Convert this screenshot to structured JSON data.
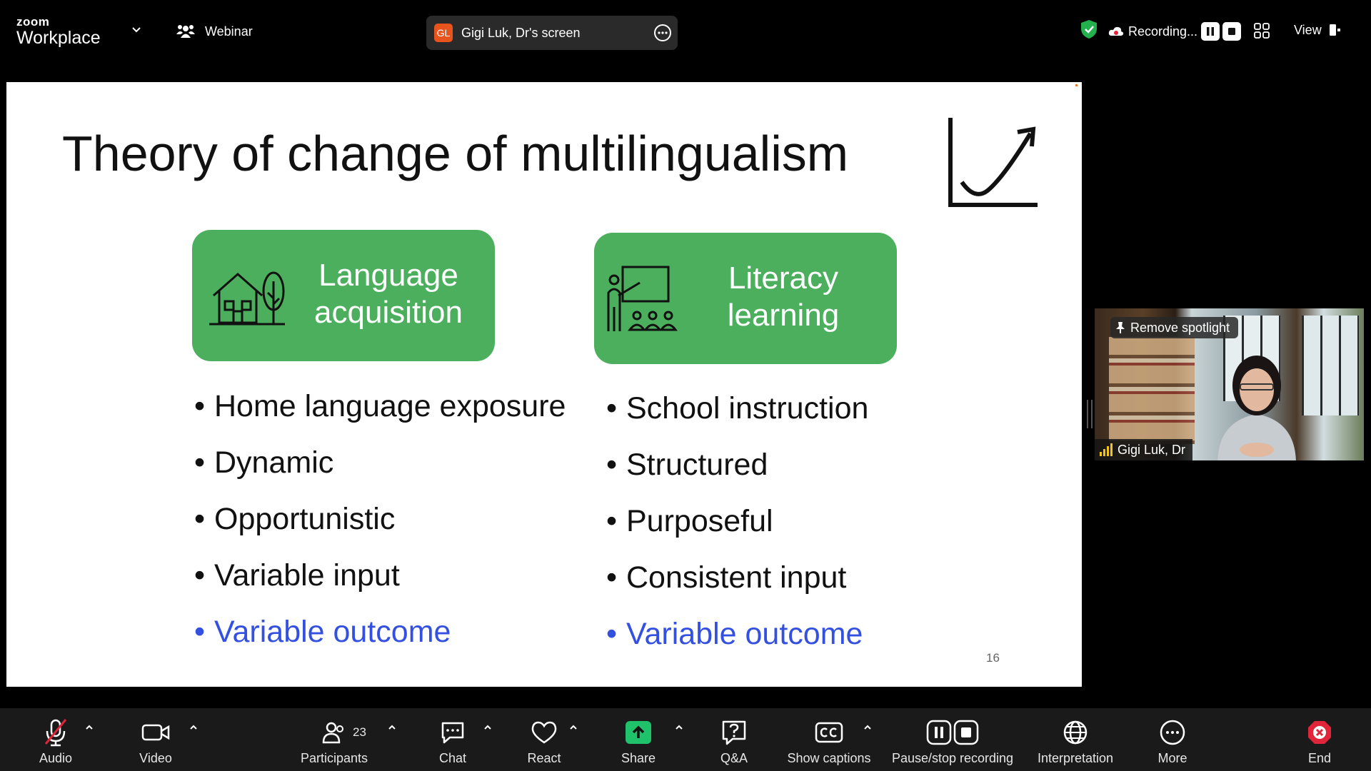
{
  "app": {
    "brand_small": "zoom",
    "brand_large": "Workplace",
    "mode_label": "Webinar"
  },
  "share": {
    "badge": "GL",
    "label": "Gigi Luk, Dr's screen"
  },
  "recording": {
    "label": "Recording...",
    "view_label": "View"
  },
  "slide": {
    "title": "Theory of change of multilingualism",
    "box1_text": "Language acquisition",
    "box2_text": "Literacy learning",
    "left_bullets": [
      "Home language exposure",
      "Dynamic",
      "Opportunistic",
      "Variable input",
      "Variable outcome"
    ],
    "right_bullets": [
      "School instruction",
      "Structured",
      "Purposeful",
      "Consistent input",
      "Variable outcome"
    ],
    "page_number": "16"
  },
  "video": {
    "spotlight_label": "Remove spotlight",
    "participant_name": "Gigi Luk, Dr"
  },
  "toolbar": {
    "audio": "Audio",
    "video": "Video",
    "participants": "Participants",
    "participant_count": "23",
    "chat": "Chat",
    "react": "React",
    "share": "Share",
    "qa": "Q&A",
    "captions": "Show captions",
    "pause_recording": "Pause/stop recording",
    "interpretation": "Interpretation",
    "more": "More",
    "end": "End"
  },
  "colors": {
    "accent_green": "#4caf5d",
    "share_green": "#1fc16b",
    "blue_text": "#3350e0",
    "end_red": "#e0243a",
    "security_green": "#22b14c"
  }
}
